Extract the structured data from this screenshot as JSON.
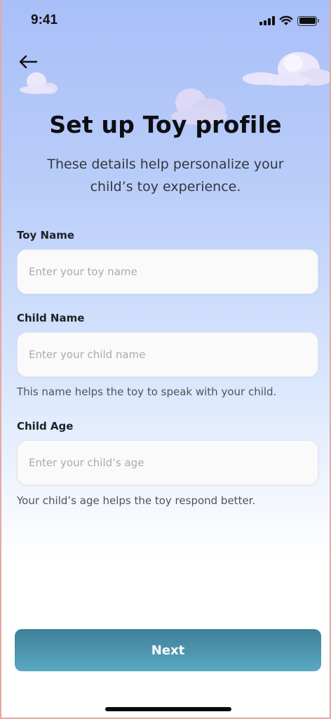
{
  "status_bar": {
    "time": "9:41",
    "icons": [
      "cellular-signal-icon",
      "wifi-icon",
      "battery-icon"
    ]
  },
  "header": {
    "back_icon": "arrow-left-icon",
    "title": "Set up Toy profile",
    "subtitle": "These details help personalize your child’s toy experience."
  },
  "form": {
    "toy_name": {
      "label": "Toy Name",
      "value": "",
      "placeholder": "Enter your toy name"
    },
    "child_name": {
      "label": "Child Name",
      "value": "",
      "placeholder": "Enter your child name",
      "hint": "This name helps the toy to speak with your child."
    },
    "child_age": {
      "label": "Child Age",
      "value": "",
      "placeholder": "Enter your child’s age",
      "hint": "Your child’s age helps the toy respond better."
    }
  },
  "footer": {
    "next_label": "Next"
  },
  "colors": {
    "background_top": "#a9bff8",
    "background_bottom": "#ffffff",
    "button_top": "#3e7f98",
    "button_bottom": "#5aa9c2",
    "title_text": "#0d0d12"
  }
}
